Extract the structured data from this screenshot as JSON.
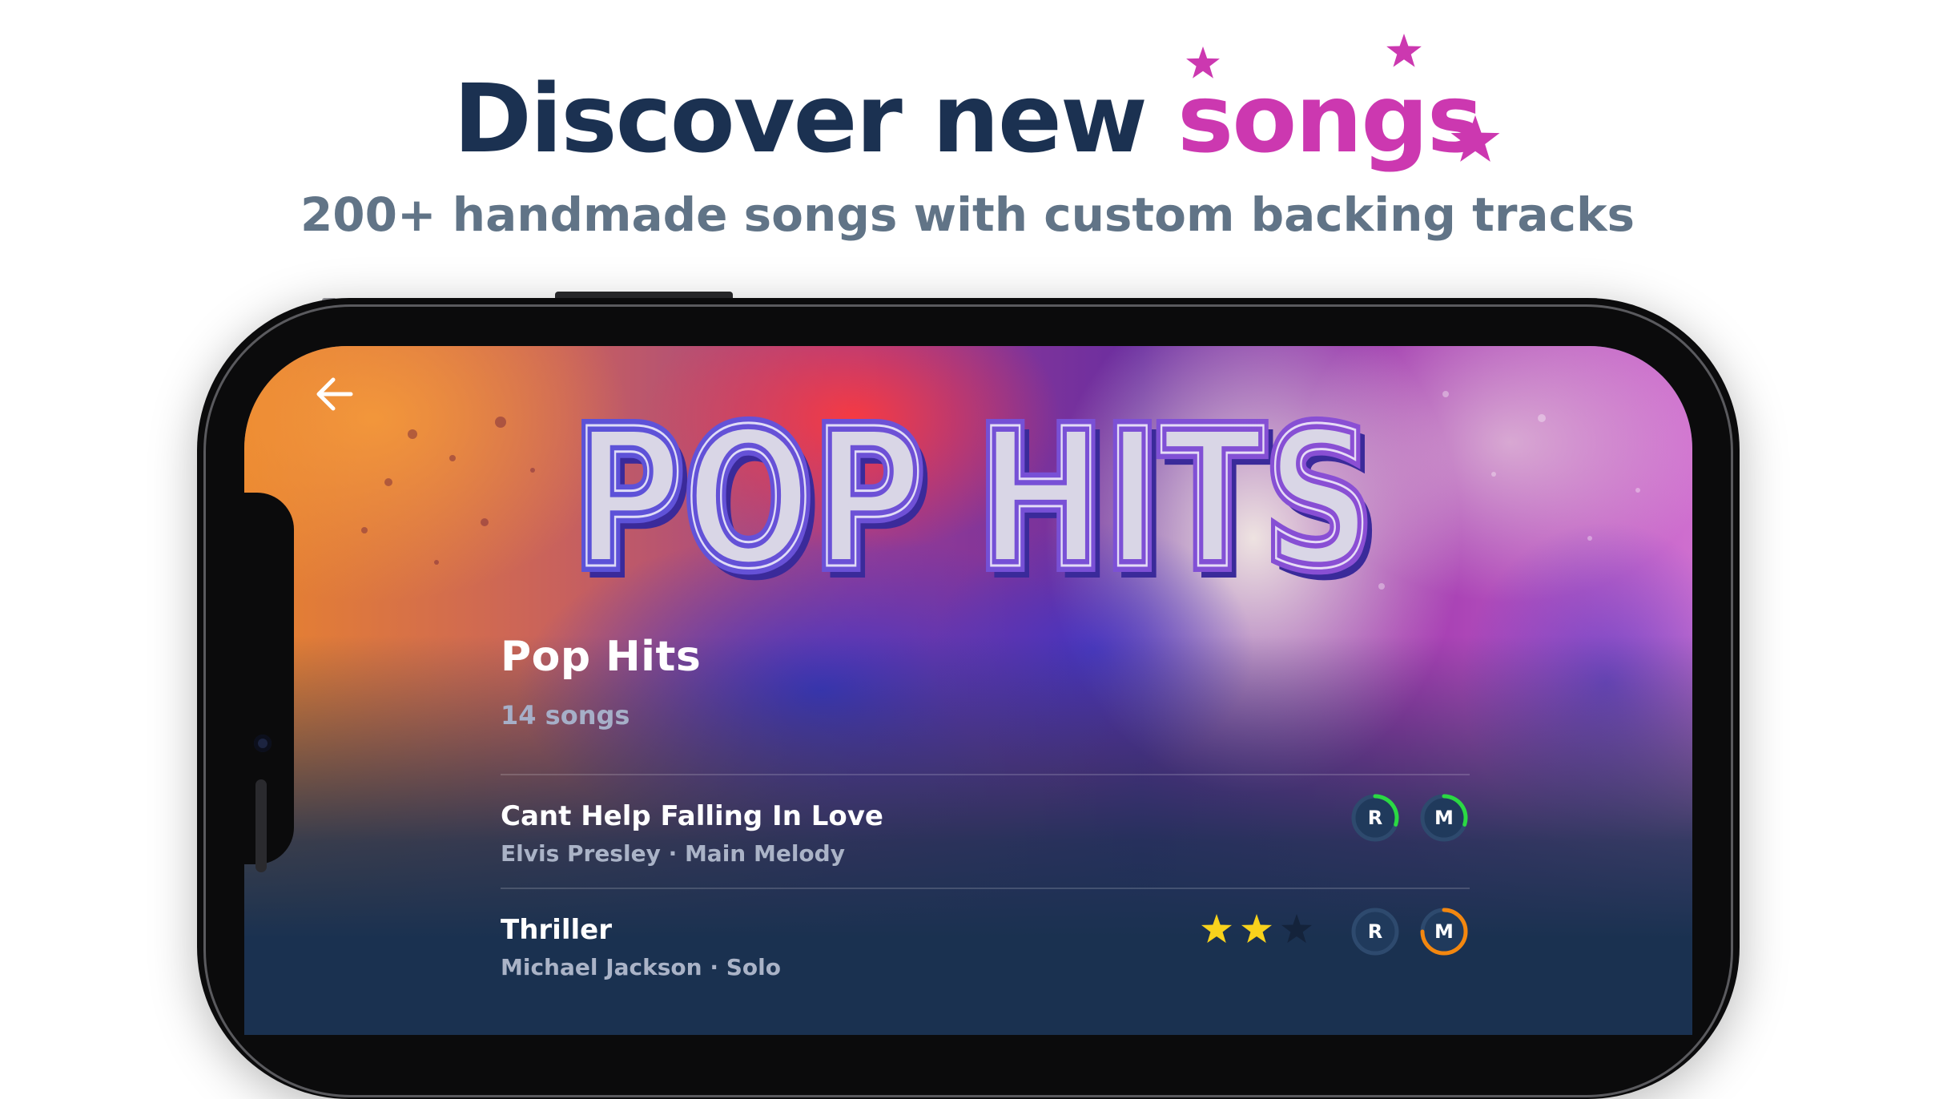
{
  "header": {
    "headline_main": "Discover new",
    "headline_accent": "songs",
    "subline": "200+ handmade songs with custom backing tracks"
  },
  "colors": {
    "headline": "#1b3151",
    "accent": "#cc38b0",
    "subline": "#617487",
    "screen_bg": "#1a3150",
    "progress_green": "#2bd943",
    "progress_orange": "#f3870f",
    "star_filled": "#f8d21c",
    "star_empty": "#14233b"
  },
  "screen": {
    "back_icon": "arrow-left-icon",
    "cover_logo": "POP HITS",
    "playlist_title": "Pop Hits",
    "playlist_count": "14 songs"
  },
  "songs": [
    {
      "title": "Cant Help Falling In Love",
      "meta": "Elvis Presley · Main Melody",
      "stars": 0,
      "badges": [
        {
          "label": "R",
          "progress": 0.3,
          "color": "#2bd943"
        },
        {
          "label": "M",
          "progress": 0.3,
          "color": "#2bd943"
        }
      ]
    },
    {
      "title": "Thriller",
      "meta": "Michael Jackson · Solo",
      "stars": 2,
      "star_total": 3,
      "badges": [
        {
          "label": "R",
          "progress": 0,
          "color": "#2bd943"
        },
        {
          "label": "M",
          "progress": 0.75,
          "color": "#f3870f"
        }
      ]
    }
  ]
}
